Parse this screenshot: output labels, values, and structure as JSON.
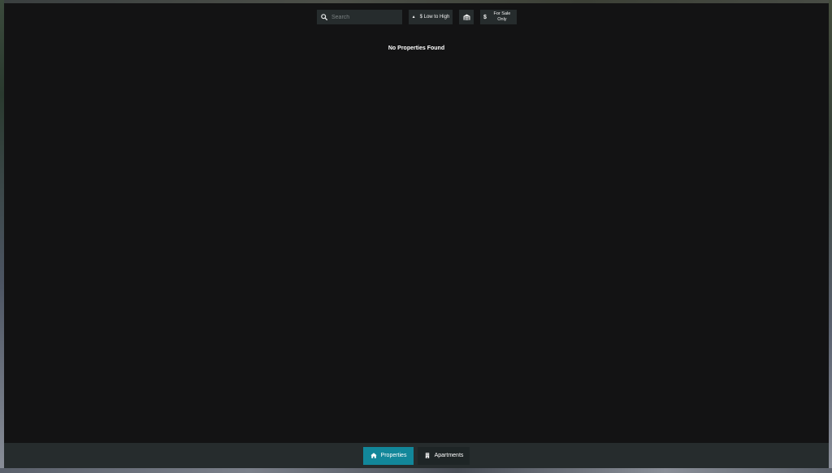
{
  "toolbar": {
    "search_placeholder": "Search",
    "sort_label": "$ Low to High",
    "sort_icon": "caret-up-icon",
    "garage_icon": "garage-icon",
    "for_sale_label": "For Sale Only",
    "for_sale_icon": "dollar-icon"
  },
  "main": {
    "empty_message": "No Properties Found"
  },
  "footer": {
    "tabs": [
      {
        "label": "Properties",
        "icon": "house-icon",
        "active": true
      },
      {
        "label": "Apartments",
        "icon": "building-icon",
        "active": false
      }
    ]
  },
  "colors": {
    "panel_bg": "#131314",
    "control_bg": "#262c2d",
    "accent": "#12879a"
  }
}
